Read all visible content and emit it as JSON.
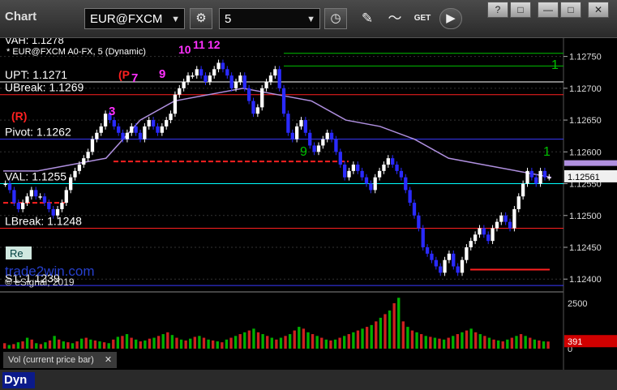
{
  "toolbar": {
    "title": "Chart",
    "symbol": "EUR@FXCM",
    "interval": "5",
    "ticker_icon": "gear-icon",
    "get_label": "GET",
    "window_buttons": [
      "?",
      "□",
      "—",
      "□",
      "✕"
    ]
  },
  "chart_info": {
    "val_top": "VAH: 1.1278",
    "symbol_line": "* EUR@FXCM A0-FX, 5 (Dynamic)",
    "copyright": "© eSignal, 2019",
    "watermark": "trade2win.com"
  },
  "levels": [
    {
      "label": "UPT: 1.1271",
      "value": 1.1271,
      "color": "#ffffff"
    },
    {
      "label": "UBreak: 1.1269",
      "value": 1.1269,
      "color": "#ff2020"
    },
    {
      "label": "Pivot: 1.1262",
      "value": 1.1262,
      "color": "#3a3aff"
    },
    {
      "label": "VAL: 1.1255",
      "value": 1.1255,
      "color": "#00ffff"
    },
    {
      "label": "LBreak: 1.1248",
      "value": 1.1248,
      "color": "#ff2020"
    },
    {
      "label": "S1: 1.1239",
      "value": 1.1239,
      "color": "#3a3aff"
    }
  ],
  "badges": {
    "r_label": "(R)",
    "p_label": "(P",
    "re_label": "Re",
    "top_counts": [
      "10",
      "11",
      "12"
    ],
    "count_7": "7",
    "count_9": "9",
    "count_1": "1",
    "count_3": "3"
  },
  "price_axis": {
    "ticks": [
      "1.12750",
      "1.12700",
      "1.12650",
      "1.12600",
      "1.12550",
      "1.12500",
      "1.12450",
      "1.12400"
    ],
    "current_price": "1.12561",
    "ma_price": "1.12569"
  },
  "time_axis": {
    "ticks": [
      "20:00",
      "12",
      "04:00",
      "08:00",
      "12:00"
    ]
  },
  "volume_panel": {
    "label": "Vol (current price bar)",
    "close_icon": "✕",
    "ticks": [
      "2500",
      "0"
    ],
    "current_volume": "391"
  },
  "bottom": {
    "dyn_label": "Dyn"
  },
  "chart_data": {
    "type": "bar",
    "symbol": "EUR@FXCM",
    "interval": "5",
    "y_range": [
      1.12385,
      1.12775
    ],
    "volume_range": [
      0,
      2900
    ],
    "closes": [
      1.1255,
      1.1254,
      1.1252,
      1.1251,
      1.1252,
      1.1253,
      1.1254,
      1.1253,
      1.1253,
      1.1252,
      1.1251,
      1.125,
      1.1251,
      1.1252,
      1.1254,
      1.1256,
      1.1257,
      1.1258,
      1.1259,
      1.126,
      1.1262,
      1.1263,
      1.1264,
      1.1266,
      1.1265,
      1.1264,
      1.1263,
      1.1262,
      1.1263,
      1.1264,
      1.1263,
      1.1262,
      1.1264,
      1.1265,
      1.1264,
      1.1263,
      1.1264,
      1.1265,
      1.1266,
      1.1269,
      1.127,
      1.1271,
      1.1272,
      1.1272,
      1.1273,
      1.1272,
      1.1271,
      1.1272,
      1.1273,
      1.1274,
      1.1273,
      1.1272,
      1.127,
      1.1271,
      1.1272,
      1.127,
      1.1268,
      1.1266,
      1.1267,
      1.127,
      1.1271,
      1.1272,
      1.1273,
      1.127,
      1.1266,
      1.1263,
      1.1262,
      1.1264,
      1.1265,
      1.1263,
      1.1261,
      1.126,
      1.1261,
      1.1262,
      1.1263,
      1.1262,
      1.126,
      1.1258,
      1.1256,
      1.1257,
      1.1258,
      1.1257,
      1.1256,
      1.1255,
      1.1254,
      1.1256,
      1.1257,
      1.1258,
      1.1259,
      1.1258,
      1.1257,
      1.1256,
      1.1254,
      1.1252,
      1.125,
      1.1248,
      1.1245,
      1.1244,
      1.1243,
      1.1242,
      1.1241,
      1.1243,
      1.1244,
      1.1242,
      1.1241,
      1.1243,
      1.1245,
      1.1246,
      1.1247,
      1.1248,
      1.1247,
      1.1246,
      1.1248,
      1.1249,
      1.125,
      1.1249,
      1.1248,
      1.1251,
      1.1253,
      1.1255,
      1.1257,
      1.1256,
      1.1255,
      1.1257,
      1.1256,
      1.1256
    ],
    "moving_average": [
      1.1257,
      1.1257,
      1.1258,
      1.1259,
      1.1265,
      1.1268,
      1.1269,
      1.127,
      1.1269,
      1.1268,
      1.1265,
      1.1264,
      1.1262,
      1.1259,
      1.1258,
      1.1257,
      1.1256
    ],
    "volumes": [
      300,
      200,
      250,
      350,
      400,
      600,
      500,
      300,
      250,
      350,
      450,
      700,
      500,
      400,
      350,
      300,
      400,
      550,
      600,
      500,
      450,
      400,
      350,
      300,
      500,
      650,
      700,
      800,
      600,
      500,
      400,
      450,
      550,
      600,
      700,
      800,
      900,
      750,
      600,
      500,
      450,
      550,
      650,
      700,
      600,
      500,
      450,
      400,
      350,
      500,
      600,
      700,
      800,
      900,
      1000,
      1100,
      900,
      800,
      700,
      600,
      500,
      600,
      700,
      800,
      1000,
      1200,
      1100,
      900,
      800,
      700,
      600,
      500,
      450,
      500,
      600,
      700,
      800,
      900,
      1000,
      1100,
      1200,
      1300,
      1500,
      1700,
      1900,
      2100,
      2500,
      2800,
      1500,
      1200,
      1000,
      900,
      800,
      700,
      650,
      600,
      550,
      500,
      600,
      700,
      800,
      900,
      1000,
      1100,
      900,
      800,
      700,
      600,
      500,
      450,
      400,
      500,
      600,
      700,
      800,
      700,
      600,
      500,
      450,
      400,
      391
    ],
    "ylabel": "",
    "xlabel": ""
  }
}
